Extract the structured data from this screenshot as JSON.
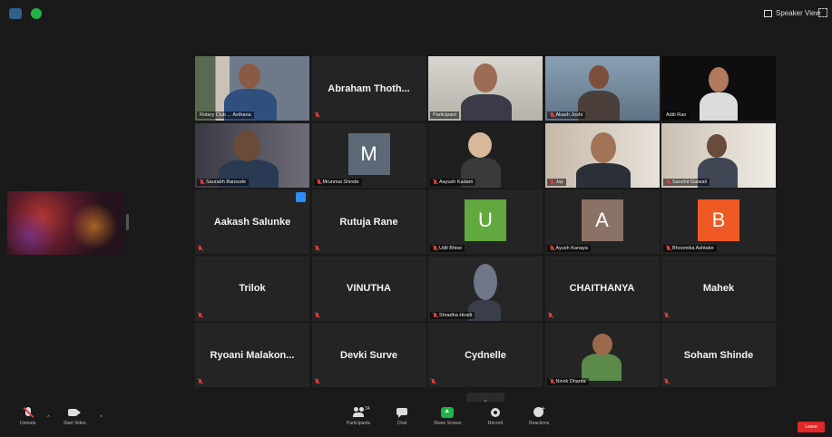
{
  "topbar": {
    "view_label": "Speaker View"
  },
  "grid": {
    "tiles": [
      {
        "name": "",
        "label": "Rotary Club ... Asthana",
        "type": "video",
        "mic": "on"
      },
      {
        "name": "Abraham  Thoth...",
        "label": "",
        "type": "name",
        "mic": "off"
      },
      {
        "name": "",
        "label": "Participant",
        "type": "video",
        "mic": "on",
        "active": true
      },
      {
        "name": "",
        "label": "Akash Joshi",
        "type": "video",
        "mic": "off"
      },
      {
        "name": "",
        "label": "Aditi Rao",
        "type": "video",
        "mic": "on"
      },
      {
        "name": "",
        "label": "Saurabh Bansode",
        "type": "video",
        "mic": "off"
      },
      {
        "name": "",
        "label": "Mrunmai Shinde",
        "type": "avatar",
        "avatar": "M",
        "avatar_color": "#5c6a78",
        "mic": "off"
      },
      {
        "name": "",
        "label": "Aayush Kadam",
        "type": "video",
        "mic": "off"
      },
      {
        "name": "",
        "label": "Jay",
        "type": "video",
        "mic": "off"
      },
      {
        "name": "",
        "label": "Sanchit Gaiwali",
        "type": "video",
        "mic": "off"
      },
      {
        "name": "Aakash Salunke",
        "label": "",
        "type": "name",
        "mic": "off",
        "pinned": true
      },
      {
        "name": "Rutuja Rane",
        "label": "",
        "type": "name",
        "mic": "off"
      },
      {
        "name": "",
        "label": "Udit Bhise",
        "type": "avatar",
        "avatar": "U",
        "avatar_color": "#61a83e",
        "mic": "off"
      },
      {
        "name": "",
        "label": "Ayush Kanaya",
        "type": "avatar",
        "avatar": "A",
        "avatar_color": "#8b7266",
        "mic": "off"
      },
      {
        "name": "",
        "label": "Bhoomika Ashtake",
        "type": "avatar",
        "avatar": "B",
        "avatar_color": "#ef5a24",
        "mic": "off"
      },
      {
        "name": "Trilok",
        "label": "",
        "type": "name",
        "mic": "off"
      },
      {
        "name": "VINUTHA",
        "label": "",
        "type": "name",
        "mic": "off"
      },
      {
        "name": "",
        "label": "Shradha Hiralli",
        "type": "video",
        "mic": "off"
      },
      {
        "name": "CHAITHANYA",
        "label": "",
        "type": "name",
        "mic": "off"
      },
      {
        "name": "Mahek",
        "label": "",
        "type": "name",
        "mic": "off"
      },
      {
        "name": "Ryoani  Malakon...",
        "label": "",
        "type": "name",
        "mic": "off"
      },
      {
        "name": "Devki Surve",
        "label": "",
        "type": "name",
        "mic": "off"
      },
      {
        "name": "Cydnelle",
        "label": "",
        "type": "name",
        "mic": "off"
      },
      {
        "name": "",
        "label": "Nirvik Dhanta",
        "type": "video",
        "mic": "off"
      },
      {
        "name": "Soham Shinde",
        "label": "",
        "type": "name",
        "mic": "off"
      }
    ]
  },
  "toolbar": {
    "unmute": "Unmute",
    "start_video": "Start Video",
    "participants": "Participants",
    "participants_count": "34",
    "chat": "Chat",
    "share_screen": "Share Screen",
    "record": "Record",
    "reactions": "Reactions",
    "leave": "Leave"
  }
}
